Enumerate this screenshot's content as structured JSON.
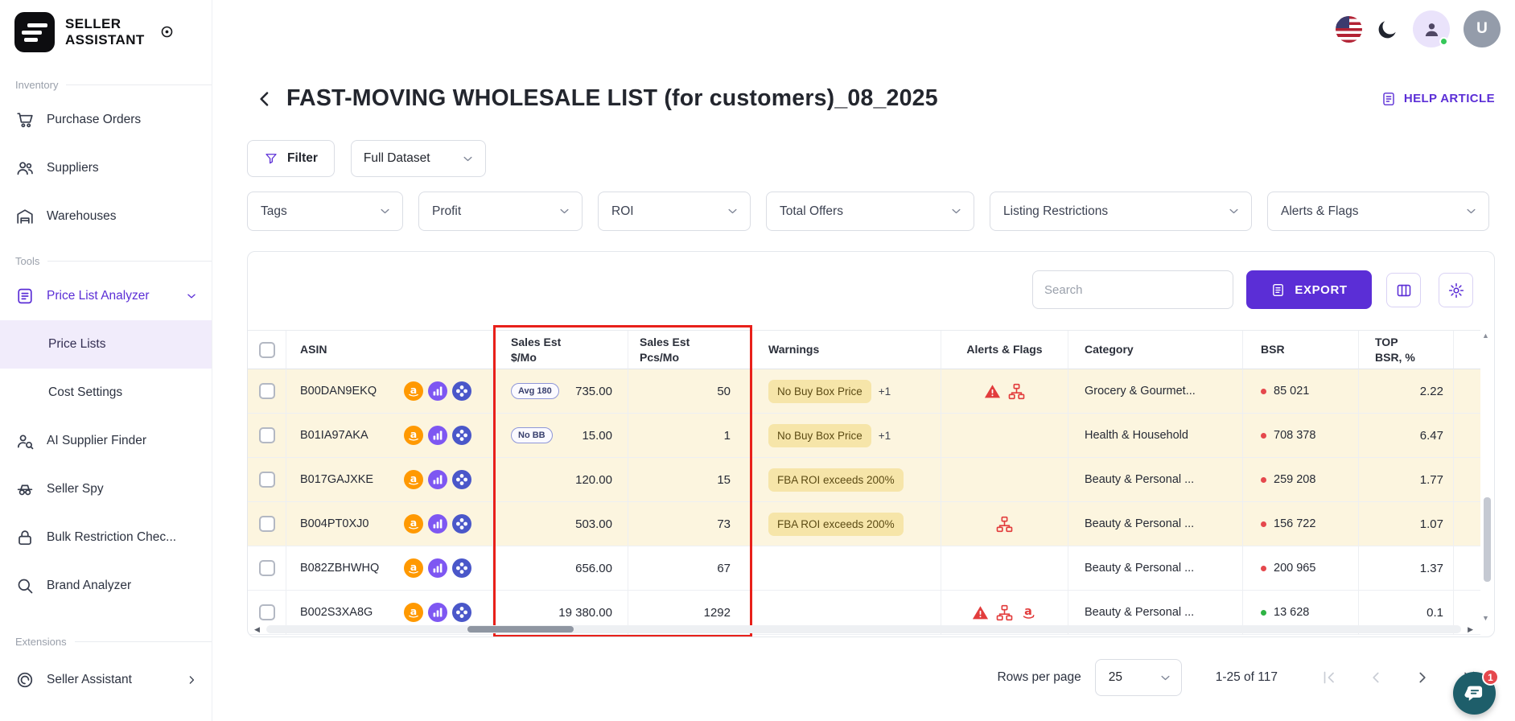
{
  "brand": {
    "line1": "SELLER",
    "line2": "ASSISTANT"
  },
  "topbar": {
    "avatar_initial": "U"
  },
  "sidebar": {
    "sections": [
      {
        "label": "Inventory",
        "items": [
          {
            "icon": "cart-icon",
            "label": "Purchase Orders"
          },
          {
            "icon": "suppliers-icon",
            "label": "Suppliers"
          },
          {
            "icon": "warehouse-icon",
            "label": "Warehouses"
          }
        ]
      },
      {
        "label": "Tools",
        "items": [
          {
            "icon": "price-list-analyzer-icon",
            "label": "Price List Analyzer",
            "state": "active",
            "trailing": "chevron-down-icon"
          },
          {
            "label": "Price Lists",
            "child": true,
            "state": "selected"
          },
          {
            "label": "Cost Settings",
            "child": true
          },
          {
            "icon": "ai-supplier-finder-icon",
            "label": "AI Supplier Finder"
          },
          {
            "icon": "seller-spy-icon",
            "label": "Seller Spy"
          },
          {
            "icon": "lock-icon",
            "label": "Bulk Restriction Chec..."
          },
          {
            "icon": "brand-analyzer-icon",
            "label": "Brand Analyzer"
          }
        ]
      },
      {
        "label": "Extensions",
        "items": [
          {
            "icon": "extension-icon",
            "label": "Seller Assistant",
            "trailing": "chevron-right-icon",
            "ext": true
          }
        ]
      }
    ]
  },
  "page": {
    "title": "FAST-MOVING WHOLESALE LIST (for customers)_08_2025",
    "help_link": "HELP ARTICLE"
  },
  "toolbar": {
    "filter_label": "Filter",
    "dataset_selector": "Full Dataset"
  },
  "filters": [
    "Tags",
    "Profit",
    "ROI",
    "Total Offers",
    "Listing Restrictions",
    "Alerts & Flags"
  ],
  "table": {
    "search_placeholder": "Search",
    "export_label": "EXPORT",
    "columns": [
      {
        "lines": [
          "ASIN"
        ]
      },
      {
        "lines": [
          "Sales Est",
          "$/Mo"
        ]
      },
      {
        "lines": [
          "Sales Est",
          "Pcs/Mo"
        ]
      },
      {
        "lines": [
          "Warnings"
        ]
      },
      {
        "lines": [
          "Alerts & Flags"
        ]
      },
      {
        "lines": [
          "Category"
        ]
      },
      {
        "lines": [
          "BSR"
        ]
      },
      {
        "lines": [
          "TOP",
          "BSR, %"
        ]
      }
    ],
    "asin_source_icons": [
      "amazon-icon",
      "chart-icon",
      "product-group-icon"
    ],
    "rows": [
      {
        "asin": "B00DAN9EKQ",
        "badge": "Avg 180",
        "sales_usd": "735.00",
        "sales_pcs": "50",
        "warning": "No Buy Box Price",
        "warning_more": "+1",
        "alerts": [
          "warning-triangle-icon",
          "sitemap-icon"
        ],
        "category": "Grocery & Gourmet...",
        "bsr": "85 021",
        "bsr_status": "red",
        "top_bsr": "2.22",
        "tinted": true
      },
      {
        "asin": "B01IA97AKA",
        "badge": "No BB",
        "sales_usd": "15.00",
        "sales_pcs": "1",
        "warning": "No Buy Box Price",
        "warning_more": "+1",
        "alerts": [],
        "category": "Health & Household",
        "bsr": "708 378",
        "bsr_status": "red",
        "top_bsr": "6.47",
        "tinted": true
      },
      {
        "asin": "B017GAJXKE",
        "badge": null,
        "sales_usd": "120.00",
        "sales_pcs": "15",
        "warning": "FBA ROI exceeds 200%",
        "warning_more": null,
        "alerts": [],
        "category": "Beauty & Personal ...",
        "bsr": "259 208",
        "bsr_status": "red",
        "top_bsr": "1.77",
        "tinted": true
      },
      {
        "asin": "B004PT0XJ0",
        "badge": null,
        "sales_usd": "503.00",
        "sales_pcs": "73",
        "warning": "FBA ROI exceeds 200%",
        "warning_more": null,
        "alerts": [
          "sitemap-icon"
        ],
        "category": "Beauty & Personal ...",
        "bsr": "156 722",
        "bsr_status": "red",
        "top_bsr": "1.07",
        "tinted": true
      },
      {
        "asin": "B082ZBHWHQ",
        "badge": null,
        "sales_usd": "656.00",
        "sales_pcs": "67",
        "warning": null,
        "warning_more": null,
        "alerts": [],
        "category": "Beauty & Personal ...",
        "bsr": "200 965",
        "bsr_status": "red",
        "top_bsr": "1.37",
        "tinted": false
      },
      {
        "asin": "B002S3XA8G",
        "badge": null,
        "sales_usd": "19 380.00",
        "sales_pcs": "1292",
        "warning": null,
        "warning_more": null,
        "alerts": [
          "warning-triangle-icon",
          "sitemap-icon",
          "amazon-alert-icon"
        ],
        "category": "Beauty & Personal ...",
        "bsr": "13 628",
        "bsr_status": "green",
        "top_bsr": "0.1",
        "tinted": false
      }
    ]
  },
  "pagination": {
    "rows_per_page_label": "Rows per page",
    "rows_per_page_value": "25",
    "range": "1-25 of 117"
  },
  "chat": {
    "unread_count": "1"
  },
  "colors": {
    "accent": "#5b2ed6",
    "alert_red": "#e5484d",
    "bsr_green": "#2fb344",
    "row_tint": "#fcf5df",
    "warning_chip_bg": "#f6e5a9",
    "annotation_red": "#e8201a",
    "chat_teal": "#1e5e6a",
    "amazon_orange": "#ff9900"
  }
}
